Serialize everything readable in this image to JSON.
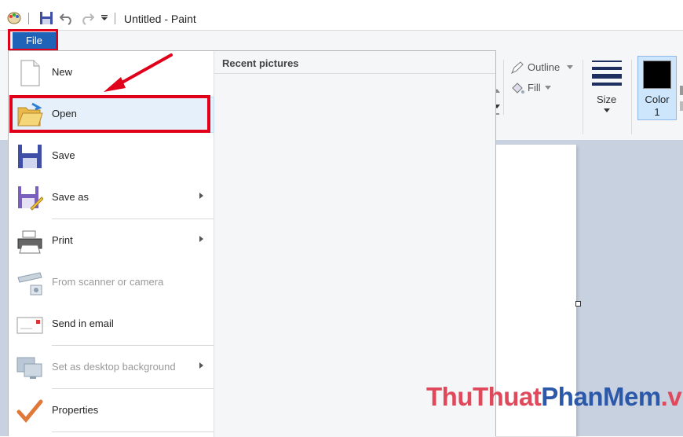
{
  "window": {
    "title": "Untitled - Paint"
  },
  "file_tab": {
    "label": "File"
  },
  "ribbon": {
    "outline_label": "Outline",
    "fill_label": "Fill",
    "size_label": "Size",
    "color1_label": "Color",
    "color1_number": "1"
  },
  "file_menu": {
    "items": [
      {
        "label": "New"
      },
      {
        "label": "Open"
      },
      {
        "label": "Save"
      },
      {
        "label": "Save as"
      },
      {
        "label": "Print"
      },
      {
        "label": "From scanner or camera"
      },
      {
        "label": "Send in email"
      },
      {
        "label": "Set as desktop background"
      },
      {
        "label": "Properties"
      }
    ],
    "recent_header": "Recent pictures"
  },
  "watermark": {
    "part1": "ThuThuat",
    "part2": "PhanMem",
    "part3": ".vn"
  },
  "colors": {
    "highlight_red": "#e0001a",
    "file_tab_blue": "#1e63b7"
  }
}
